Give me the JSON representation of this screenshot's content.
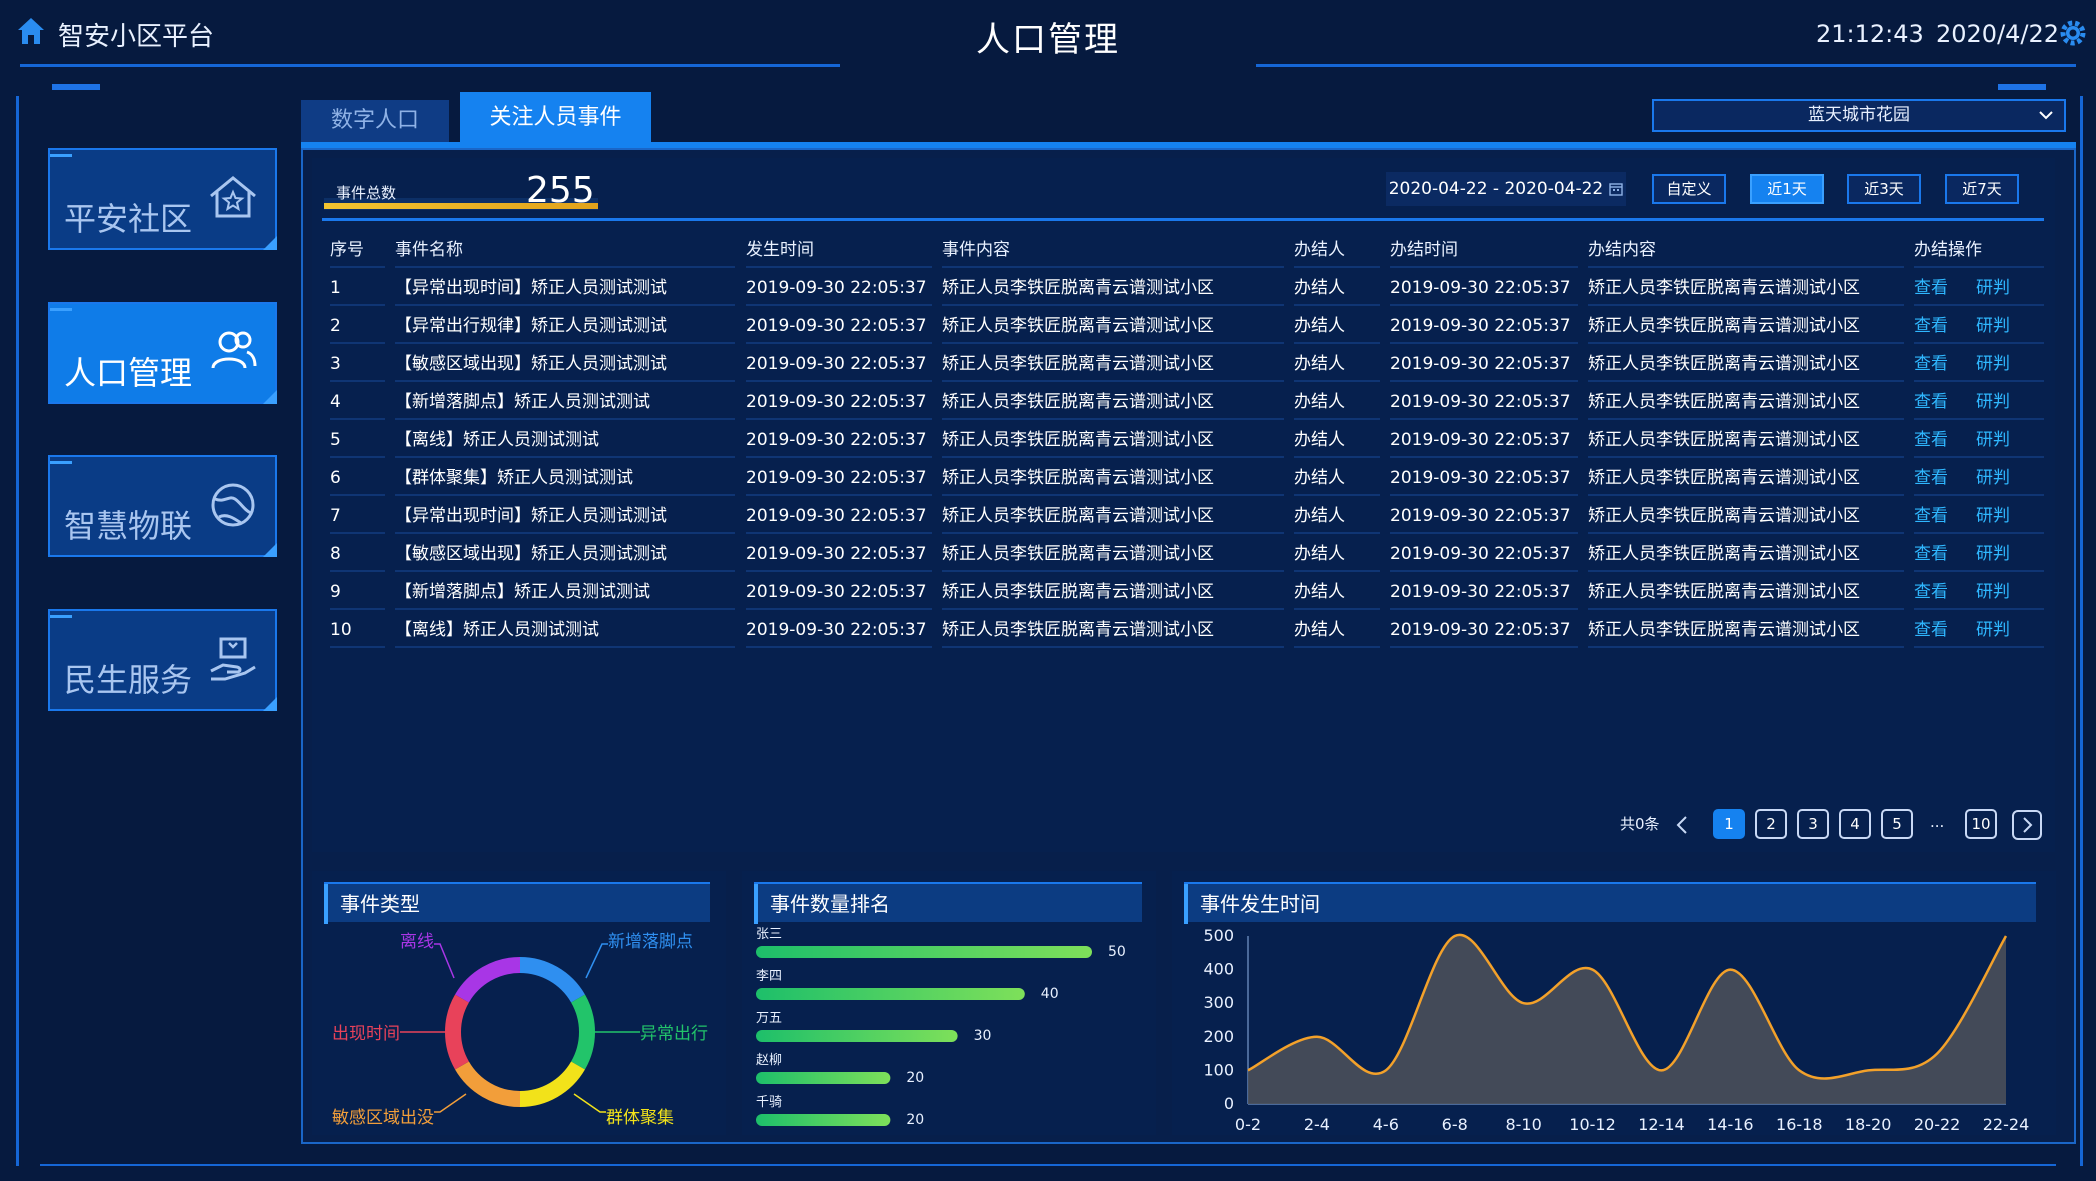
{
  "header": {
    "app_title": "智安小区平台",
    "page_title": "人口管理",
    "time": "21:12:43",
    "date": "2020/4/22"
  },
  "sidebar": {
    "items": [
      {
        "label": "平安社区",
        "icon": "house-star-icon",
        "active": false
      },
      {
        "label": "人口管理",
        "icon": "people-icon",
        "active": true
      },
      {
        "label": "智慧物联",
        "icon": "globe-icon",
        "active": false
      },
      {
        "label": "民生服务",
        "icon": "hand-service-icon",
        "active": false
      }
    ]
  },
  "tabs": [
    {
      "label": "数字人口",
      "active": false
    },
    {
      "label": "关注人员事件",
      "active": true
    }
  ],
  "community_select": {
    "value": "蓝天城市花园"
  },
  "summary": {
    "total_label": "事件总数",
    "total_value": "255"
  },
  "filters": {
    "date_range": "2020-04-22 - 2020-04-22",
    "buttons": [
      {
        "label": "自定义",
        "active": false
      },
      {
        "label": "近1天",
        "active": true
      },
      {
        "label": "近3天",
        "active": false
      },
      {
        "label": "近7天",
        "active": false
      }
    ]
  },
  "table": {
    "columns": [
      "序号",
      "事件名称",
      "发生时间",
      "事件内容",
      "办结人",
      "办结时间",
      "办结内容",
      "办结操作"
    ],
    "action_view": "查看",
    "action_judge": "研判",
    "rows": [
      [
        "1",
        "【异常出现时间】矫正人员测试测试",
        "2019-09-30 22:05:37",
        "矫正人员李铁匠脱离青云谱测试小区",
        "办结人",
        "2019-09-30 22:05:37",
        "矫正人员李铁匠脱离青云谱测试小区"
      ],
      [
        "2",
        "【异常出行规律】矫正人员测试测试",
        "2019-09-30 22:05:37",
        "矫正人员李铁匠脱离青云谱测试小区",
        "办结人",
        "2019-09-30 22:05:37",
        "矫正人员李铁匠脱离青云谱测试小区"
      ],
      [
        "3",
        "【敏感区域出现】矫正人员测试测试",
        "2019-09-30 22:05:37",
        "矫正人员李铁匠脱离青云谱测试小区",
        "办结人",
        "2019-09-30 22:05:37",
        "矫正人员李铁匠脱离青云谱测试小区"
      ],
      [
        "4",
        "【新增落脚点】矫正人员测试测试",
        "2019-09-30 22:05:37",
        "矫正人员李铁匠脱离青云谱测试小区",
        "办结人",
        "2019-09-30 22:05:37",
        "矫正人员李铁匠脱离青云谱测试小区"
      ],
      [
        "5",
        "【离线】矫正人员测试测试",
        "2019-09-30 22:05:37",
        "矫正人员李铁匠脱离青云谱测试小区",
        "办结人",
        "2019-09-30 22:05:37",
        "矫正人员李铁匠脱离青云谱测试小区"
      ],
      [
        "6",
        "【群体聚集】矫正人员测试测试",
        "2019-09-30 22:05:37",
        "矫正人员李铁匠脱离青云谱测试小区",
        "办结人",
        "2019-09-30 22:05:37",
        "矫正人员李铁匠脱离青云谱测试小区"
      ],
      [
        "7",
        "【异常出现时间】矫正人员测试测试",
        "2019-09-30 22:05:37",
        "矫正人员李铁匠脱离青云谱测试小区",
        "办结人",
        "2019-09-30 22:05:37",
        "矫正人员李铁匠脱离青云谱测试小区"
      ],
      [
        "8",
        "【敏感区域出现】矫正人员测试测试",
        "2019-09-30 22:05:37",
        "矫正人员李铁匠脱离青云谱测试小区",
        "办结人",
        "2019-09-30 22:05:37",
        "矫正人员李铁匠脱离青云谱测试小区"
      ],
      [
        "9",
        "【新增落脚点】矫正人员测试测试",
        "2019-09-30 22:05:37",
        "矫正人员李铁匠脱离青云谱测试小区",
        "办结人",
        "2019-09-30 22:05:37",
        "矫正人员李铁匠脱离青云谱测试小区"
      ],
      [
        "10",
        "【离线】矫正人员测试测试",
        "2019-09-30 22:05:37",
        "矫正人员李铁匠脱离青云谱测试小区",
        "办结人",
        "2019-09-30 22:05:37",
        "矫正人员李铁匠脱离青云谱测试小区"
      ]
    ]
  },
  "pager": {
    "total_text": "共0条",
    "pages": [
      "1",
      "2",
      "3",
      "4",
      "5"
    ],
    "ellipsis": "...",
    "last_page": "10",
    "current": "1"
  },
  "charts": {
    "event_type_title": "事件类型",
    "ranking_title": "事件数量排名",
    "time_title": "事件发生时间"
  },
  "chart_data": [
    {
      "type": "pie",
      "title": "事件类型",
      "labels": [
        "新增落脚点",
        "异常出行",
        "群体聚集",
        "敏感区域出没",
        "出现时间",
        "离线"
      ],
      "values": [
        1,
        1,
        1,
        1,
        1,
        1
      ],
      "colors": [
        "#2f8ff0",
        "#22c46a",
        "#f2e21a",
        "#f29e3a",
        "#e8425a",
        "#a836e6"
      ]
    },
    {
      "type": "bar",
      "title": "事件数量排名",
      "categories": [
        "张三",
        "李四",
        "万五",
        "赵柳",
        "千骑"
      ],
      "values": [
        50,
        40,
        30,
        20,
        20
      ],
      "xlim": [
        0,
        50
      ]
    },
    {
      "type": "area",
      "title": "事件发生时间",
      "categories": [
        "0-2",
        "2-4",
        "4-6",
        "6-8",
        "8-10",
        "10-12",
        "12-14",
        "14-16",
        "16-18",
        "18-20",
        "20-22",
        "22-24"
      ],
      "values": [
        100,
        200,
        100,
        500,
        300,
        400,
        100,
        400,
        100,
        100,
        150,
        500
      ],
      "ylim": [
        0,
        500
      ],
      "yticks": [
        0,
        100,
        200,
        300,
        400,
        500
      ],
      "colors": {
        "line": "#f3a12a",
        "fill": "#4a4f5a"
      }
    }
  ]
}
